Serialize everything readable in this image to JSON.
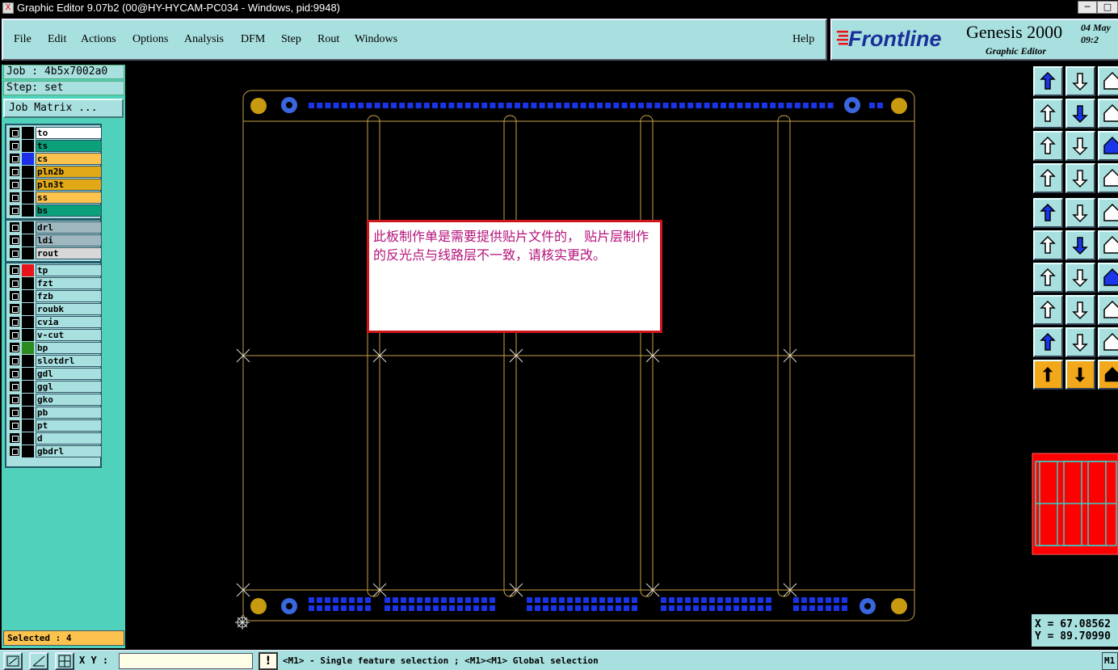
{
  "window": {
    "title": "Graphic Editor 9.07b2 (00@HY-HYCAM-PC034 - Windows, pid:9948)",
    "minimize": "─",
    "maximize": "□",
    "close": "✕"
  },
  "menu": {
    "items": [
      {
        "label": "File"
      },
      {
        "label": "Edit"
      },
      {
        "label": "Actions"
      },
      {
        "label": "Options"
      },
      {
        "label": "Analysis"
      },
      {
        "label": "DFM"
      },
      {
        "label": "Step"
      },
      {
        "label": "Rout"
      },
      {
        "label": "Windows"
      }
    ],
    "help": "Help"
  },
  "brand": {
    "logo": "Frontline",
    "product": "Genesis 2000",
    "subtitle": "Graphic Editor",
    "date_line1": "04",
    "date_line2": "May",
    "time": "09:2"
  },
  "job": {
    "job_label": "Job : 4b5x7002a0",
    "step_label": "Step: set",
    "job_matrix": "Job Matrix ..."
  },
  "layers": [
    {
      "name": "to",
      "bg": "#ffffff",
      "color": ""
    },
    {
      "name": "ts",
      "bg": "#0aa079",
      "color": ""
    },
    {
      "name": "cs",
      "bg": "#fbc34e",
      "color": "#1c2ee6"
    },
    {
      "name": "pln2b",
      "bg": "#e1a818",
      "color": ""
    },
    {
      "name": "pln3t",
      "bg": "#e1a818",
      "color": ""
    },
    {
      "name": "ss",
      "bg": "#fbc34e",
      "color": ""
    },
    {
      "name": "bs",
      "bg": "#0aa079",
      "color": ""
    },
    {
      "name": "drl",
      "bg": "#9fb8c0",
      "color": ""
    },
    {
      "name": "ldi",
      "bg": "#9fb8c0",
      "color": ""
    },
    {
      "name": "rout",
      "bg": "#d8d8d8",
      "color": ""
    },
    {
      "name": "tp",
      "bg": "#a8e0df",
      "color": "#e8141a"
    },
    {
      "name": "fzt",
      "bg": "#a8e0df",
      "color": ""
    },
    {
      "name": "fzb",
      "bg": "#a8e0df",
      "color": ""
    },
    {
      "name": "roubk",
      "bg": "#a8e0df",
      "color": ""
    },
    {
      "name": "cvia",
      "bg": "#a8e0df",
      "color": ""
    },
    {
      "name": "v-cut",
      "bg": "#a8e0df",
      "color": ""
    },
    {
      "name": "bp",
      "bg": "#a8e0df",
      "color": "#2c8a1e"
    },
    {
      "name": "slotdrl",
      "bg": "#a8e0df",
      "color": ""
    },
    {
      "name": "gdl",
      "bg": "#a8e0df",
      "color": ""
    },
    {
      "name": "ggl",
      "bg": "#a8e0df",
      "color": ""
    },
    {
      "name": "gko",
      "bg": "#a8e0df",
      "color": ""
    },
    {
      "name": "pb",
      "bg": "#a8e0df",
      "color": ""
    },
    {
      "name": "pt",
      "bg": "#a8e0df",
      "color": ""
    },
    {
      "name": "d",
      "bg": "#a8e0df",
      "color": ""
    },
    {
      "name": "gbdrl",
      "bg": "#a8e0df",
      "color": ""
    }
  ],
  "selected": "Selected : 4",
  "message": "此板制作单是需要提供贴片文件的， 贴片层制作的反光点与线路层不一致，请核实更改。",
  "coords": {
    "x": "X = 67.08562",
    "y": "Y = 89.70990"
  },
  "bottom": {
    "xy_label": "X Y :",
    "xy_value": "",
    "excl": "!",
    "status": "<M1> - Single feature selection ; <M1><M1> Global selection",
    "end": "M1"
  },
  "colors": {
    "panel": "#a8e0df",
    "panel_dark": "#4fd1bc",
    "board_outline": "#c8a048",
    "pad_gold": "#c89a10",
    "pad_blue": "#1a35e8",
    "fiducial": "#3a66e0"
  }
}
